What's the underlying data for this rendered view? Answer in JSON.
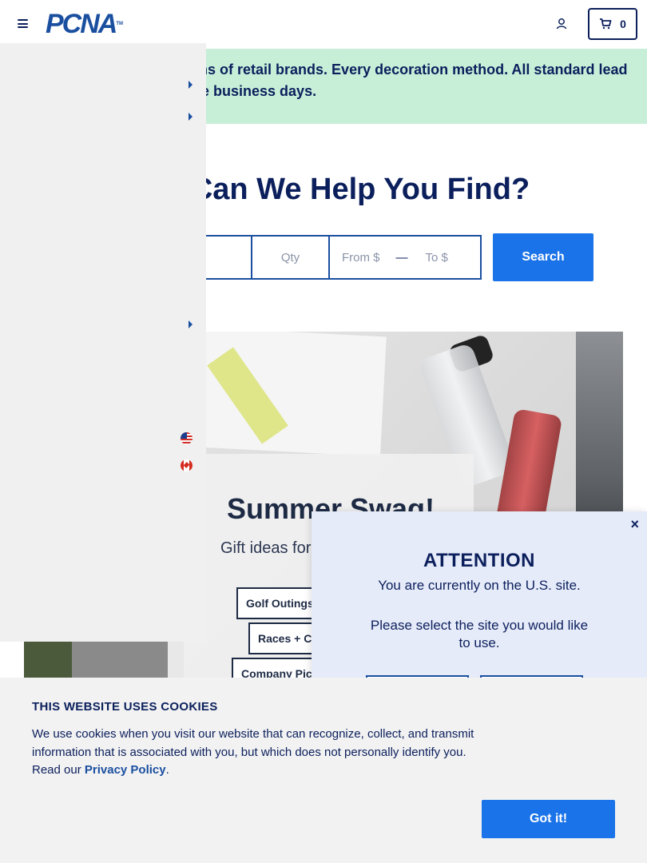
{
  "header": {
    "logo_text": "PCNA",
    "logo_tm": "TM",
    "cart_count": "0"
  },
  "banner": {
    "text": "roducts. Dozens of retail brands. Every decoration method. All standard lead time of just five business days."
  },
  "search": {
    "headline": "Can We Help You Find?",
    "qty_placeholder": "Qty",
    "from_placeholder": "From $",
    "dash": "—",
    "to_placeholder": "To $",
    "button_label": "Search"
  },
  "promo": {
    "title": "Summer Swag!",
    "subtitle": "Gift ideas for",
    "categories": [
      "Golf Outings",
      "Races + C",
      "Company Pic"
    ]
  },
  "attention": {
    "close": "×",
    "title": "ATTENTION",
    "message": "You are currently on the U.S. site.",
    "prompt": "Please select the site you would like to use."
  },
  "cookie": {
    "title": "THIS WEBSITE USES COOKIES",
    "body": "We use cookies when you visit our website that can recognize, collect, and transmit information that is associated with you, but which does not personally identify you. Read our ",
    "link": "Privacy Policy",
    "suffix": ".",
    "button": "Got it!"
  },
  "icons": {
    "menu": "hamburger-icon",
    "account": "user-icon",
    "cart": "cart-icon",
    "flag_us": "us-flag-icon",
    "flag_ca": "canada-flag-icon"
  }
}
